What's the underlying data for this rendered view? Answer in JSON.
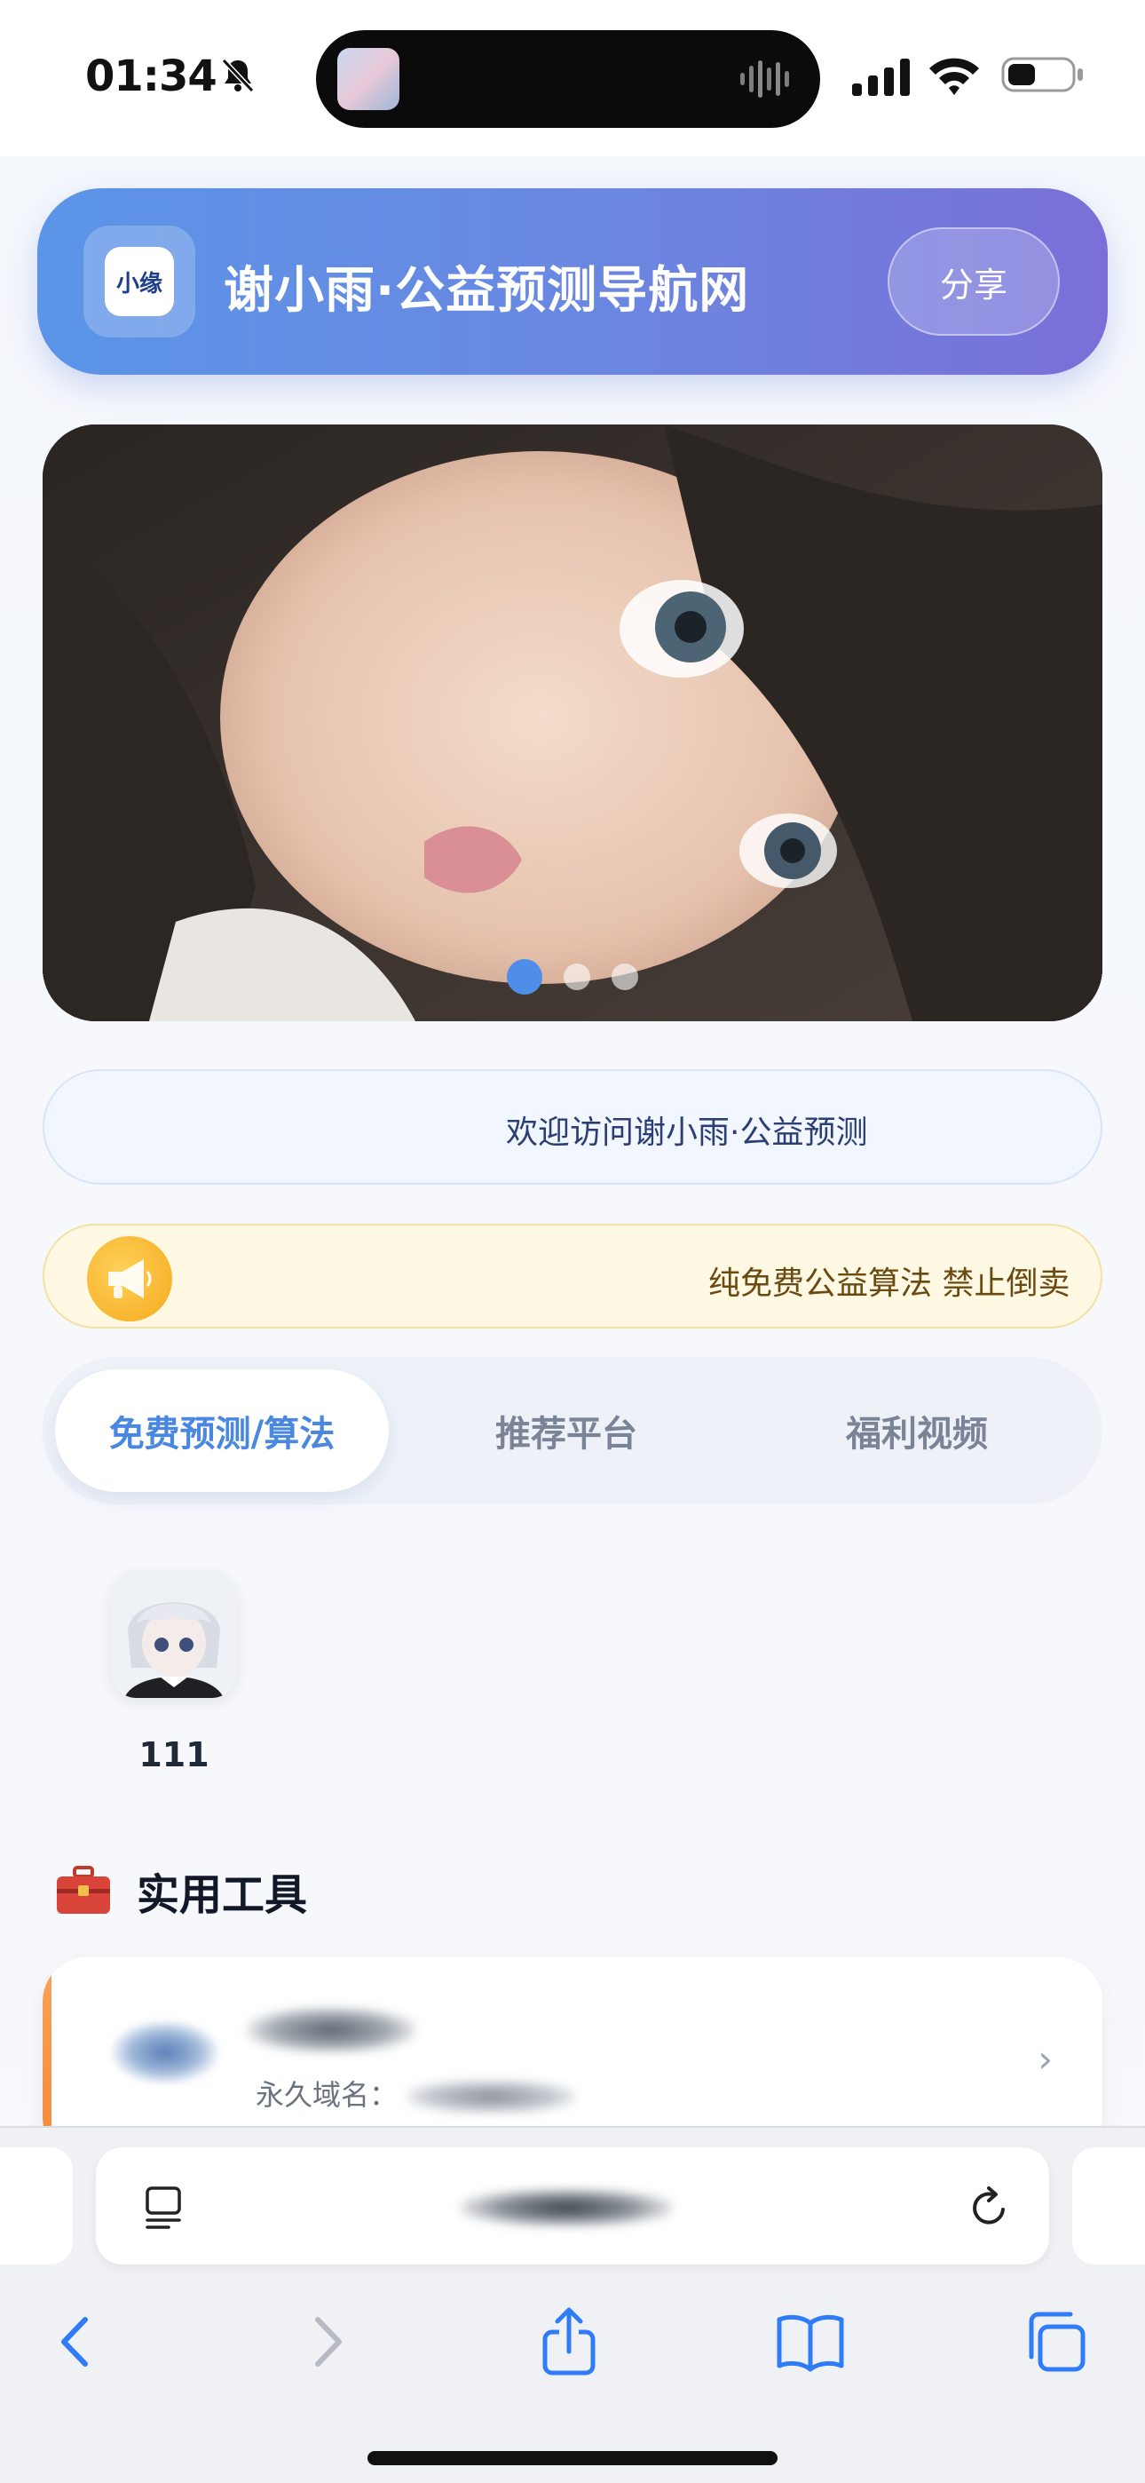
{
  "status_bar": {
    "time": "01:34",
    "icons": [
      "bell-muted-icon",
      "signal-icon",
      "wifi-icon",
      "battery-icon"
    ]
  },
  "header": {
    "logo_text": "小缘",
    "title": "谢小雨·公益预测导航网",
    "share_label": "分享",
    "colors": {
      "gradient_start": "#5b95e8",
      "gradient_end": "#7a6fd8"
    }
  },
  "carousel": {
    "slide_count": 3,
    "active_index": 0,
    "accent": "#4f8ee8"
  },
  "welcome": {
    "text": "欢迎访问谢小雨·公益预测"
  },
  "notice": {
    "icon": "megaphone-icon",
    "text": "纯免费公益算法 禁止倒卖"
  },
  "tabs": [
    {
      "label": "免费预测/算法",
      "active": true
    },
    {
      "label": "推荐平台",
      "active": false
    },
    {
      "label": "福利视频",
      "active": false
    }
  ],
  "apps": [
    {
      "label": "111"
    }
  ],
  "tools_section": {
    "icon": "toolbox-icon",
    "title": "实用工具",
    "cards": [
      {
        "domain_label": "永久域名："
      }
    ]
  },
  "browser": {
    "toolbar_icons": [
      "back-icon",
      "forward-icon",
      "share-icon",
      "bookmarks-icon",
      "tabs-icon"
    ]
  }
}
